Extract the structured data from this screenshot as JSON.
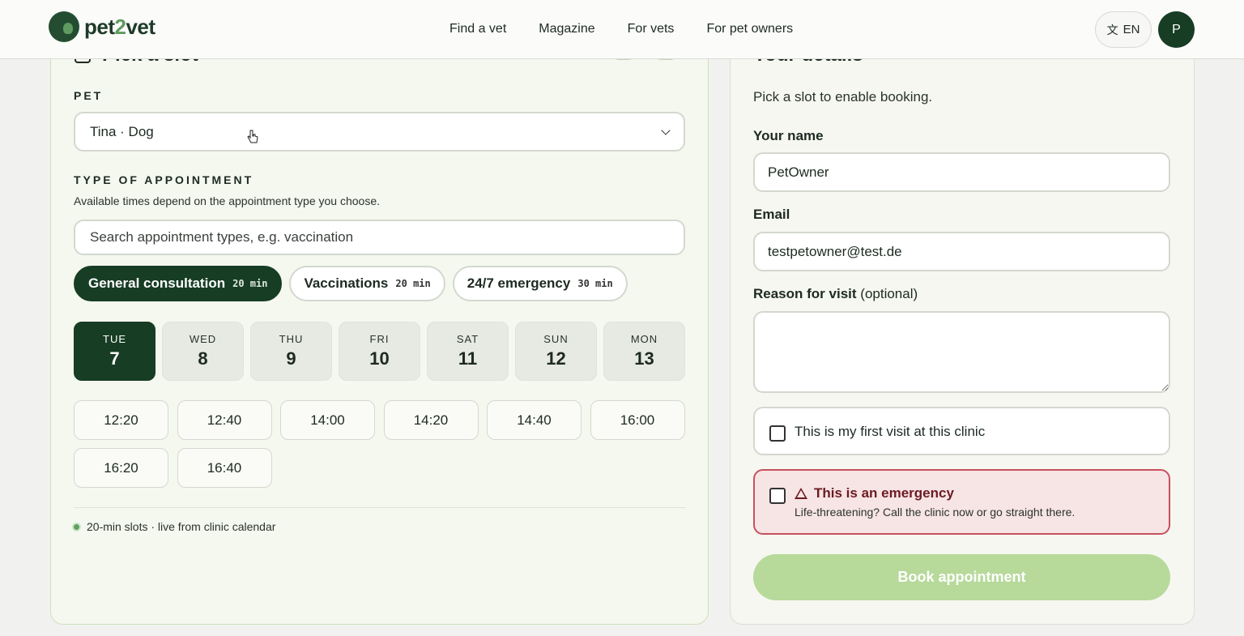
{
  "header": {
    "brand_prefix": "pet",
    "brand_two": "2",
    "brand_suffix": "vet",
    "nav": [
      "Find a vet",
      "Magazine",
      "For vets",
      "For pet owners"
    ],
    "language": "EN",
    "avatar_initial": "P"
  },
  "left_card": {
    "heading": "Pick a slot",
    "pet_label": "PET",
    "pet_value": "Tina · Dog",
    "appointment_label": "TYPE OF APPOINTMENT",
    "appointment_hint": "Available times depend on the appointment type you choose.",
    "search_placeholder": "Search appointment types, e.g. vaccination",
    "types": [
      {
        "label": "General consultation",
        "duration": "20 min",
        "active": true
      },
      {
        "label": "Vaccinations",
        "duration": "20 min",
        "active": false
      },
      {
        "label": "24/7 emergency",
        "duration": "30 min",
        "active": false
      }
    ],
    "days": [
      {
        "dow": "TUE",
        "num": "7",
        "active": true
      },
      {
        "dow": "WED",
        "num": "8",
        "active": false
      },
      {
        "dow": "THU",
        "num": "9",
        "active": false
      },
      {
        "dow": "FRI",
        "num": "10",
        "active": false
      },
      {
        "dow": "SAT",
        "num": "11",
        "active": false
      },
      {
        "dow": "SUN",
        "num": "12",
        "active": false
      },
      {
        "dow": "MON",
        "num": "13",
        "active": false
      }
    ],
    "slots": [
      "12:20",
      "12:40",
      "14:00",
      "14:20",
      "14:40",
      "16:00",
      "16:20",
      "16:40"
    ],
    "status": "20-min slots · live from clinic calendar"
  },
  "right_card": {
    "heading": "Your details",
    "hint": "Pick a slot to enable booking.",
    "name_label": "Your name",
    "name_value": "PetOwner",
    "email_label": "Email",
    "email_value": "testpetowner@test.de",
    "reason_label": "Reason for visit",
    "reason_optional": "(optional)",
    "first_visit": "This is my first visit at this clinic",
    "emergency_title": "This is an emergency",
    "emergency_text": "Life-threatening? Call the clinic now or go straight there.",
    "book_button": "Book appointment"
  },
  "colors": {
    "brand_dark": "#173d24",
    "brand_light": "#5f9b61",
    "book_disabled": "#b7d99a",
    "emergency_border": "#c7505d",
    "emergency_bg": "#f7e4e4"
  }
}
